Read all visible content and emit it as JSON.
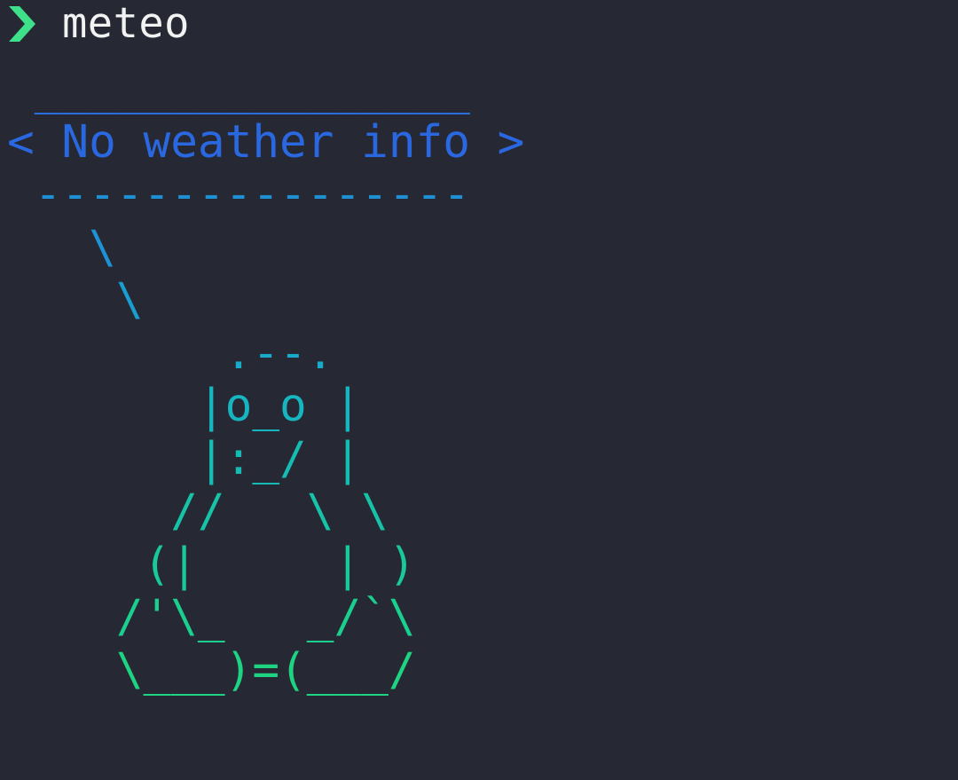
{
  "terminal": {
    "prompt_symbol": "chevron-right-icon",
    "prompt_color": "#3ee08a",
    "command": "meteo"
  },
  "output": {
    "bubble_top": " ________________",
    "bubble_text": "< No weather info >",
    "bubble_bottom": " ----------------",
    "tux_lines": [
      "   \\",
      "    \\",
      "        .--.",
      "       |o_o |",
      "       |:_/ |",
      "      //   \\ \\",
      "     (|     | )",
      "    /'\\_   _/`\\",
      "    \\___)=(___/"
    ],
    "tux_colors": [
      "#1e92d6",
      "#1a9dd1",
      "#18aac8",
      "#17b5c0",
      "#16bcb4",
      "#17c3a6",
      "#19c99a",
      "#1bcf8e",
      "#1ed483"
    ],
    "bubble_colors": {
      "top": "#2a6fe0",
      "text": "#2a68e2",
      "bottom": "#1e8fd2"
    }
  }
}
